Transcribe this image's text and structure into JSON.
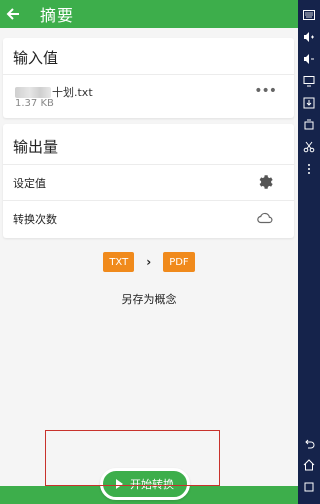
{
  "appbar": {
    "title": "摘要"
  },
  "input_card": {
    "title": "输入值",
    "file_name_suffix": "十划.txt",
    "file_size": "1.37 KB",
    "more_label": "•••"
  },
  "output_card": {
    "title": "输出量",
    "rows": [
      {
        "label": "设定值",
        "icon": "gear-icon"
      },
      {
        "label": "转换次数",
        "icon": "cloud-icon"
      }
    ]
  },
  "format": {
    "from": "TXT",
    "to": "PDF"
  },
  "save_as_label": "另存为概念",
  "start_button_label": "开始转换",
  "toolbar": {
    "icons": [
      "keyboard-icon",
      "volume-up-icon",
      "volume-down-icon",
      "screen-icon",
      "import-icon",
      "device-icon",
      "scissors-icon",
      "more-icon",
      "back-icon",
      "home-icon",
      "recent-apps-icon"
    ]
  },
  "colors": {
    "green": "#3dae4b",
    "orange": "#f08a1c",
    "highlight_red": "#c8322c",
    "toolbar_bg": "#15234b"
  }
}
